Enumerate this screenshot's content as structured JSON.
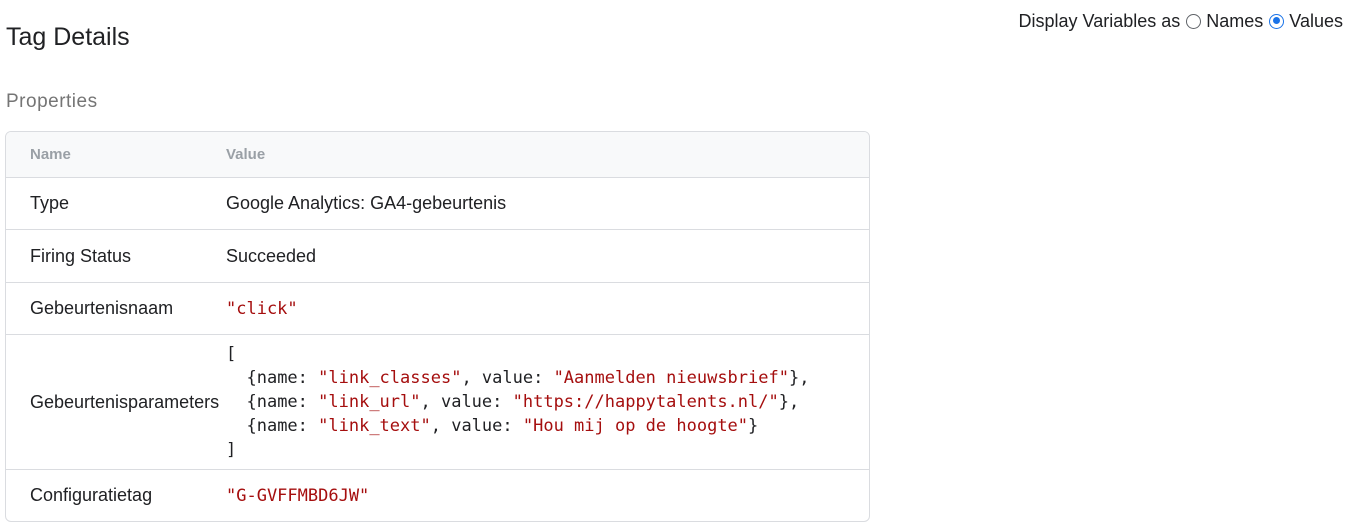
{
  "page": {
    "title": "Tag Details"
  },
  "display_variables": {
    "label": "Display Variables as",
    "options": [
      {
        "label": "Names",
        "selected": false
      },
      {
        "label": "Values",
        "selected": true
      }
    ],
    "accent_color": "#1a73e8"
  },
  "properties": {
    "section_title": "Properties",
    "columns": [
      "Name",
      "Value"
    ],
    "rows": [
      {
        "name": "Type",
        "value": "Google Analytics: GA4-gebeurtenis"
      },
      {
        "name": "Firing Status",
        "value": "Succeeded"
      },
      {
        "name": "Gebeurtenisnaam",
        "value": "\"click\""
      },
      {
        "name": "Gebeurtenisparameters",
        "value": {
          "open": "[",
          "close": "]",
          "params": [
            {
              "key_label": "{name: ",
              "name": "\"link_classes\"",
              "sep": ", value: ",
              "value": "\"Aanmelden nieuwsbrief\"",
              "end": "},"
            },
            {
              "key_label": "{name: ",
              "name": "\"link_url\"",
              "sep": ", value: ",
              "value": "\"https://happytalents.nl/\"",
              "end": "},"
            },
            {
              "key_label": "{name: ",
              "name": "\"link_text\"",
              "sep": ", value: ",
              "value": "\"Hou mij op de hoogte\"",
              "end": "}"
            }
          ]
        }
      },
      {
        "name": "Configuratietag",
        "value": "\"G-GVFFMBD6JW\""
      }
    ],
    "string_color": "#a50e0e"
  }
}
